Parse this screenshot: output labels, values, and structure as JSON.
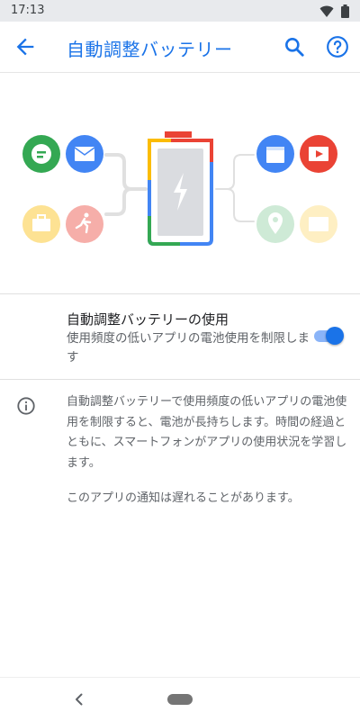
{
  "status_bar": {
    "time": "17:13"
  },
  "app_bar": {
    "title": "自動調整バッテリー"
  },
  "adaptive_toggle": {
    "title": "自動調整バッテリーの使用",
    "summary": "使用頻度の低いアプリの電池使用を制限します",
    "checked": true
  },
  "info": {
    "paragraph1": "自動調整バッテリーで使用頻度の低いアプリの電池使用を制限すると、電池が長持ちします。時間の経過とともに、スマートフォンがアプリの使用状況を学習します。",
    "paragraph2": "このアプリの通知は遅れることがあります。"
  },
  "colors": {
    "accent": "#1a73e8",
    "accent_light": "#8ab4f8",
    "green": "#34a853",
    "blue": "#4285f4",
    "red": "#ea4335",
    "yellow": "#fbbc04",
    "battery_fill": "#dadce0"
  },
  "icons": {
    "back": "arrow-back-icon",
    "search": "search-icon",
    "help": "help-icon",
    "info": "info-icon"
  }
}
